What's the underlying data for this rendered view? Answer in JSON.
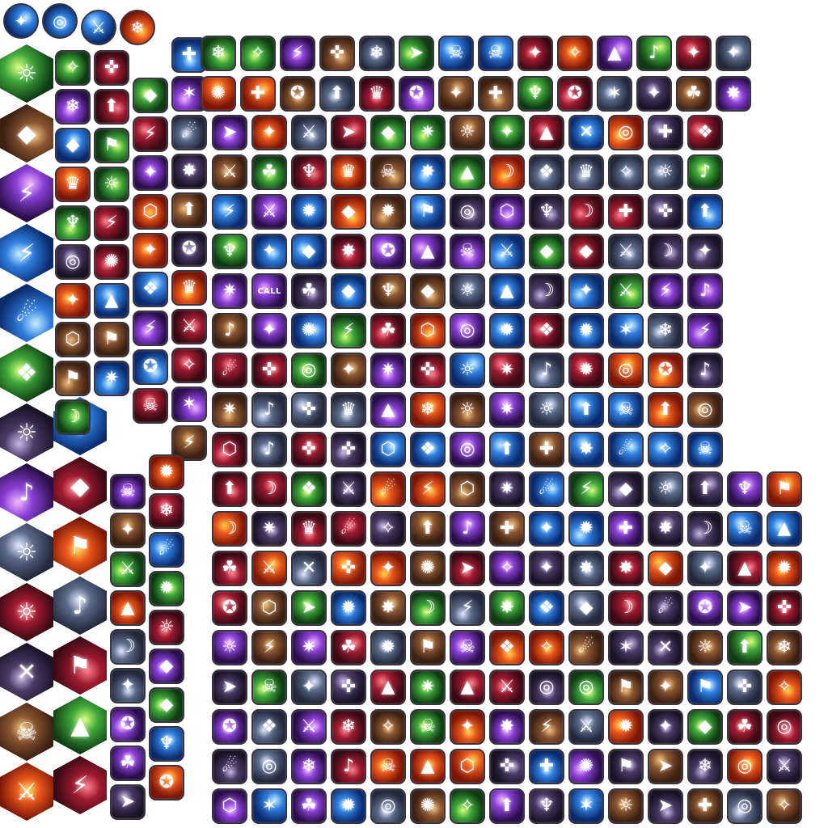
{
  "sheet": {
    "labels": {
      "call": "CALL"
    },
    "palettes": {
      "fire": [
        "#7a1608",
        "#e8561a",
        "#ffd24a"
      ],
      "ice": [
        "#0b2a6b",
        "#2f7fe0",
        "#c8f0ff"
      ],
      "arcane": [
        "#2a0f4a",
        "#8a3fd6",
        "#f0b8ff"
      ],
      "nature": [
        "#0f3a14",
        "#3fa83a",
        "#d8ff7a"
      ],
      "earth": [
        "#3a1f12",
        "#8a5530",
        "#f0c07a"
      ],
      "shadow": [
        "#1a1326",
        "#4a3a66",
        "#c8b8e8"
      ],
      "steel": [
        "#22283a",
        "#5a6a8a",
        "#e0e8ff"
      ],
      "blood": [
        "#3a0a14",
        "#a01a30",
        "#ff8090"
      ]
    },
    "glyph_set": [
      "✦",
      "✧",
      "⚔",
      "☄",
      "❄",
      "✺",
      "☠",
      "♪",
      "✚",
      "➤",
      "✸",
      "✪",
      "◆",
      "☼",
      "⚡",
      "✹",
      "❖",
      "✷",
      "✶",
      "⚑",
      "☘",
      "♆",
      "♛",
      "✜",
      "⬆",
      "✕",
      "◎",
      "⬡",
      "▲",
      "☽"
    ]
  }
}
